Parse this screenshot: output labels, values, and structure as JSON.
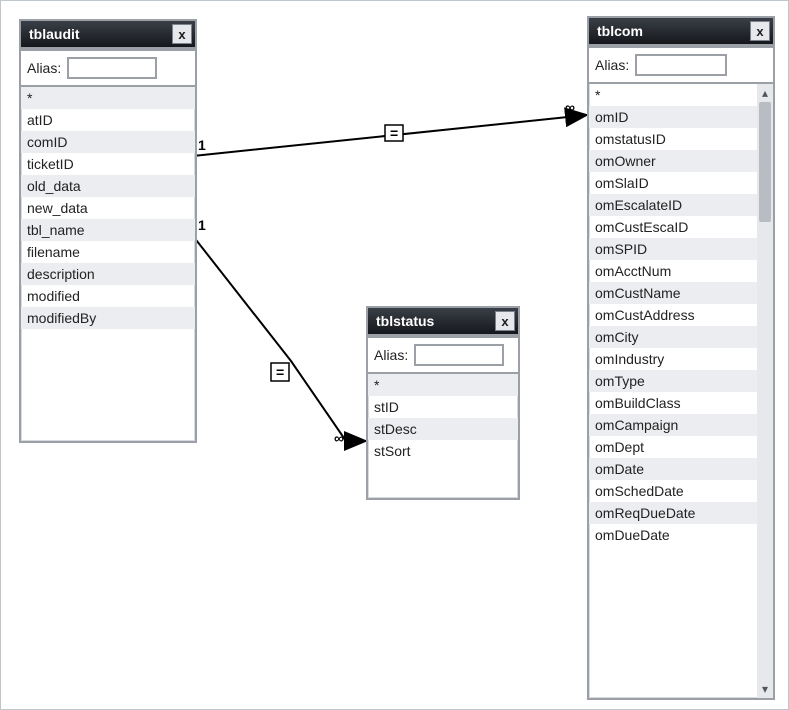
{
  "labels": {
    "alias": "Alias:"
  },
  "tables": [
    {
      "name": "tblaudit",
      "alias": "",
      "alt_offset": 1,
      "fields": [
        "*",
        "atID",
        "comID",
        "ticketID",
        "old_data",
        "new_data",
        "tbl_name",
        "filename",
        "description",
        "modified",
        "modifiedBy"
      ]
    },
    {
      "name": "tblstatus",
      "alias": "",
      "alt_offset": 1,
      "fields": [
        "*",
        "stID",
        "stDesc",
        "stSort"
      ]
    },
    {
      "name": "tblcom",
      "alias": "",
      "alt_offset": 0,
      "fields": [
        "*",
        "omID",
        "omstatusID",
        "omOwner",
        "omSlaID",
        "omEscalateID",
        "omCustEscaID",
        "omSPID",
        "omAcctNum",
        "omCustName",
        "omCustAddress",
        "omCity",
        "omIndustry",
        "omType",
        "omBuildClass",
        "omCampaign",
        "omDept",
        "omDate",
        "omSchedDate",
        "omReqDueDate",
        "omDueDate"
      ]
    }
  ],
  "joins": [
    {
      "from_table": "tblaudit",
      "from_field": "comID",
      "from_card": "1",
      "op": "=",
      "to_table": "tblcom",
      "to_field": "omID",
      "to_card": "∞"
    },
    {
      "from_table": "tblaudit",
      "from_field": "new_data",
      "from_card": "1",
      "op": "=",
      "to_table": "tblstatus",
      "to_field": "stID",
      "to_card": "∞"
    }
  ]
}
